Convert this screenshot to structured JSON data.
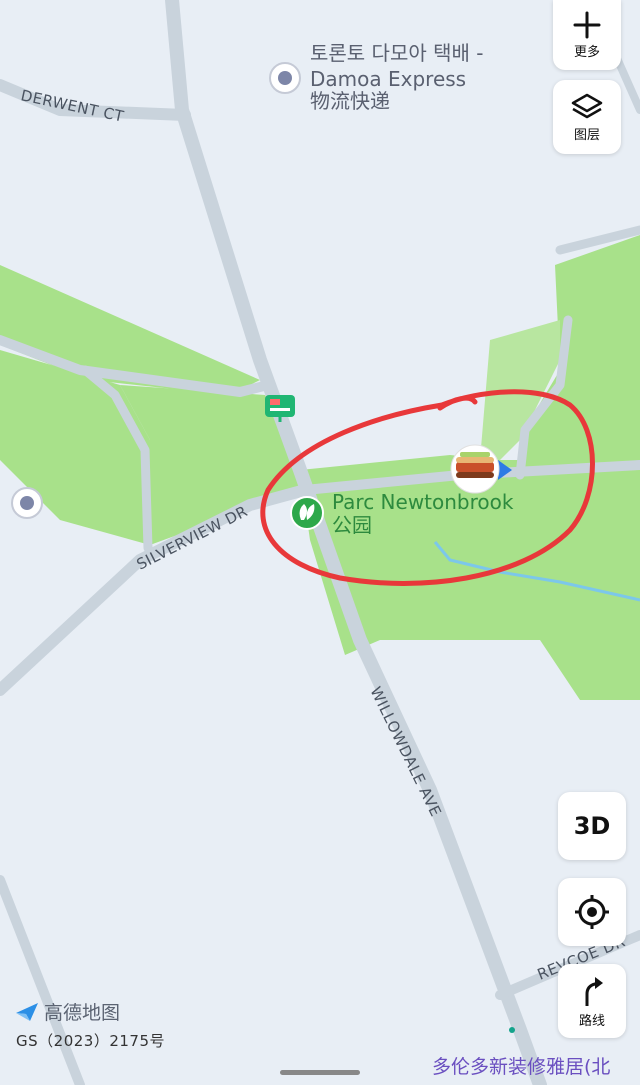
{
  "map": {
    "roads": {
      "derwent": "DERWENT CT",
      "silverview": "SILVERVIEW DR",
      "willowdale": "WILLOWDALE AVE",
      "revcoe": "REVCOE DR"
    },
    "pois": {
      "damoa_line1": "토론토 다모아 택배 -",
      "damoa_line2": "Damoa Express",
      "damoa_line3": "物流快递",
      "park_name": "Parc Newtonbrook",
      "park_type": "公园"
    },
    "colors": {
      "background": "#e8eef5",
      "park": "#a8e18a",
      "road": "#c9d3dc",
      "annotation": "#e8383a",
      "stream": "#7cc7ea"
    },
    "annotation": "red hand-drawn circle around Parc Newtonbrook"
  },
  "controls": {
    "more_label": "更多",
    "layers_label": "图层",
    "three_d_label": "3D",
    "route_label": "路线",
    "more_icon": "plus-icon",
    "layers_icon": "layers-icon",
    "locate_icon": "locate-icon",
    "route_icon": "route-arrow-icon"
  },
  "footer": {
    "logo_text": "高德地图",
    "license": "GS（2023）2175号",
    "bottom_poi": "多伦多新装修雅居(北"
  }
}
